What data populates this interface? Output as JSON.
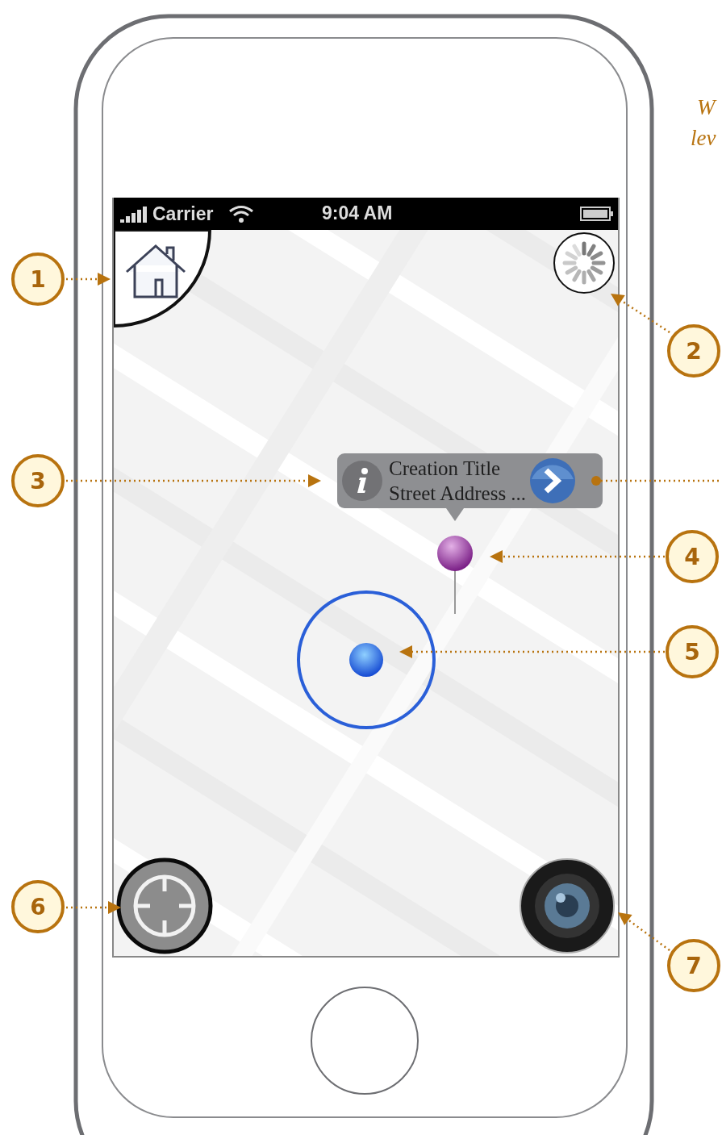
{
  "status_bar": {
    "carrier": "Carrier",
    "time": "9:04 AM"
  },
  "callout": {
    "title": "Creation Title",
    "subtitle": "Street Address ..."
  },
  "annotations": [
    {
      "number": "1"
    },
    {
      "number": "2"
    },
    {
      "number": "3"
    },
    {
      "number": "4"
    },
    {
      "number": "5"
    },
    {
      "number": "6"
    },
    {
      "number": "7"
    }
  ],
  "note": {
    "lines": [
      "W",
      "lev"
    ]
  }
}
